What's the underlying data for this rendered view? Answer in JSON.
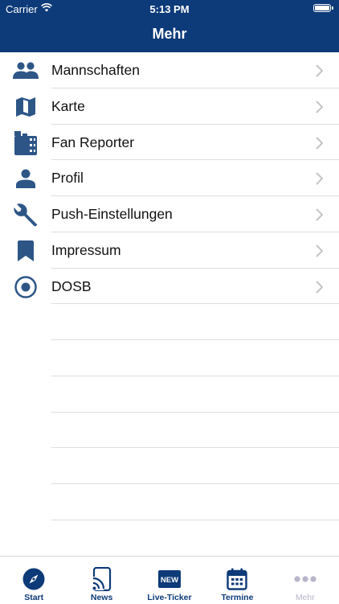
{
  "status_bar": {
    "carrier": "Carrier",
    "time": "5:13 PM"
  },
  "nav": {
    "title": "Mehr"
  },
  "colors": {
    "brand": "#0d3a78",
    "icon": "#2d5687",
    "inactive_tab": "#b8b4c9"
  },
  "menu": {
    "items": [
      {
        "label": "Mannschaften",
        "icon": "people-icon"
      },
      {
        "label": "Karte",
        "icon": "map-icon"
      },
      {
        "label": "Fan Reporter",
        "icon": "film-icon"
      },
      {
        "label": "Profil",
        "icon": "person-icon"
      },
      {
        "label": "Push-Einstellungen",
        "icon": "wrench-icon"
      },
      {
        "label": "Impressum",
        "icon": "bookmark-icon"
      },
      {
        "label": "DOSB",
        "icon": "target-icon"
      }
    ]
  },
  "tabbar": {
    "tabs": [
      {
        "label": "Start",
        "icon": "compass-icon"
      },
      {
        "label": "News",
        "icon": "news-cast-icon"
      },
      {
        "label": "Live-Ticker",
        "icon": "new-badge-icon",
        "badge": "NEW"
      },
      {
        "label": "Termine",
        "icon": "calendar-icon"
      },
      {
        "label": "Mehr",
        "icon": "more-dots-icon",
        "selected": true
      }
    ]
  }
}
